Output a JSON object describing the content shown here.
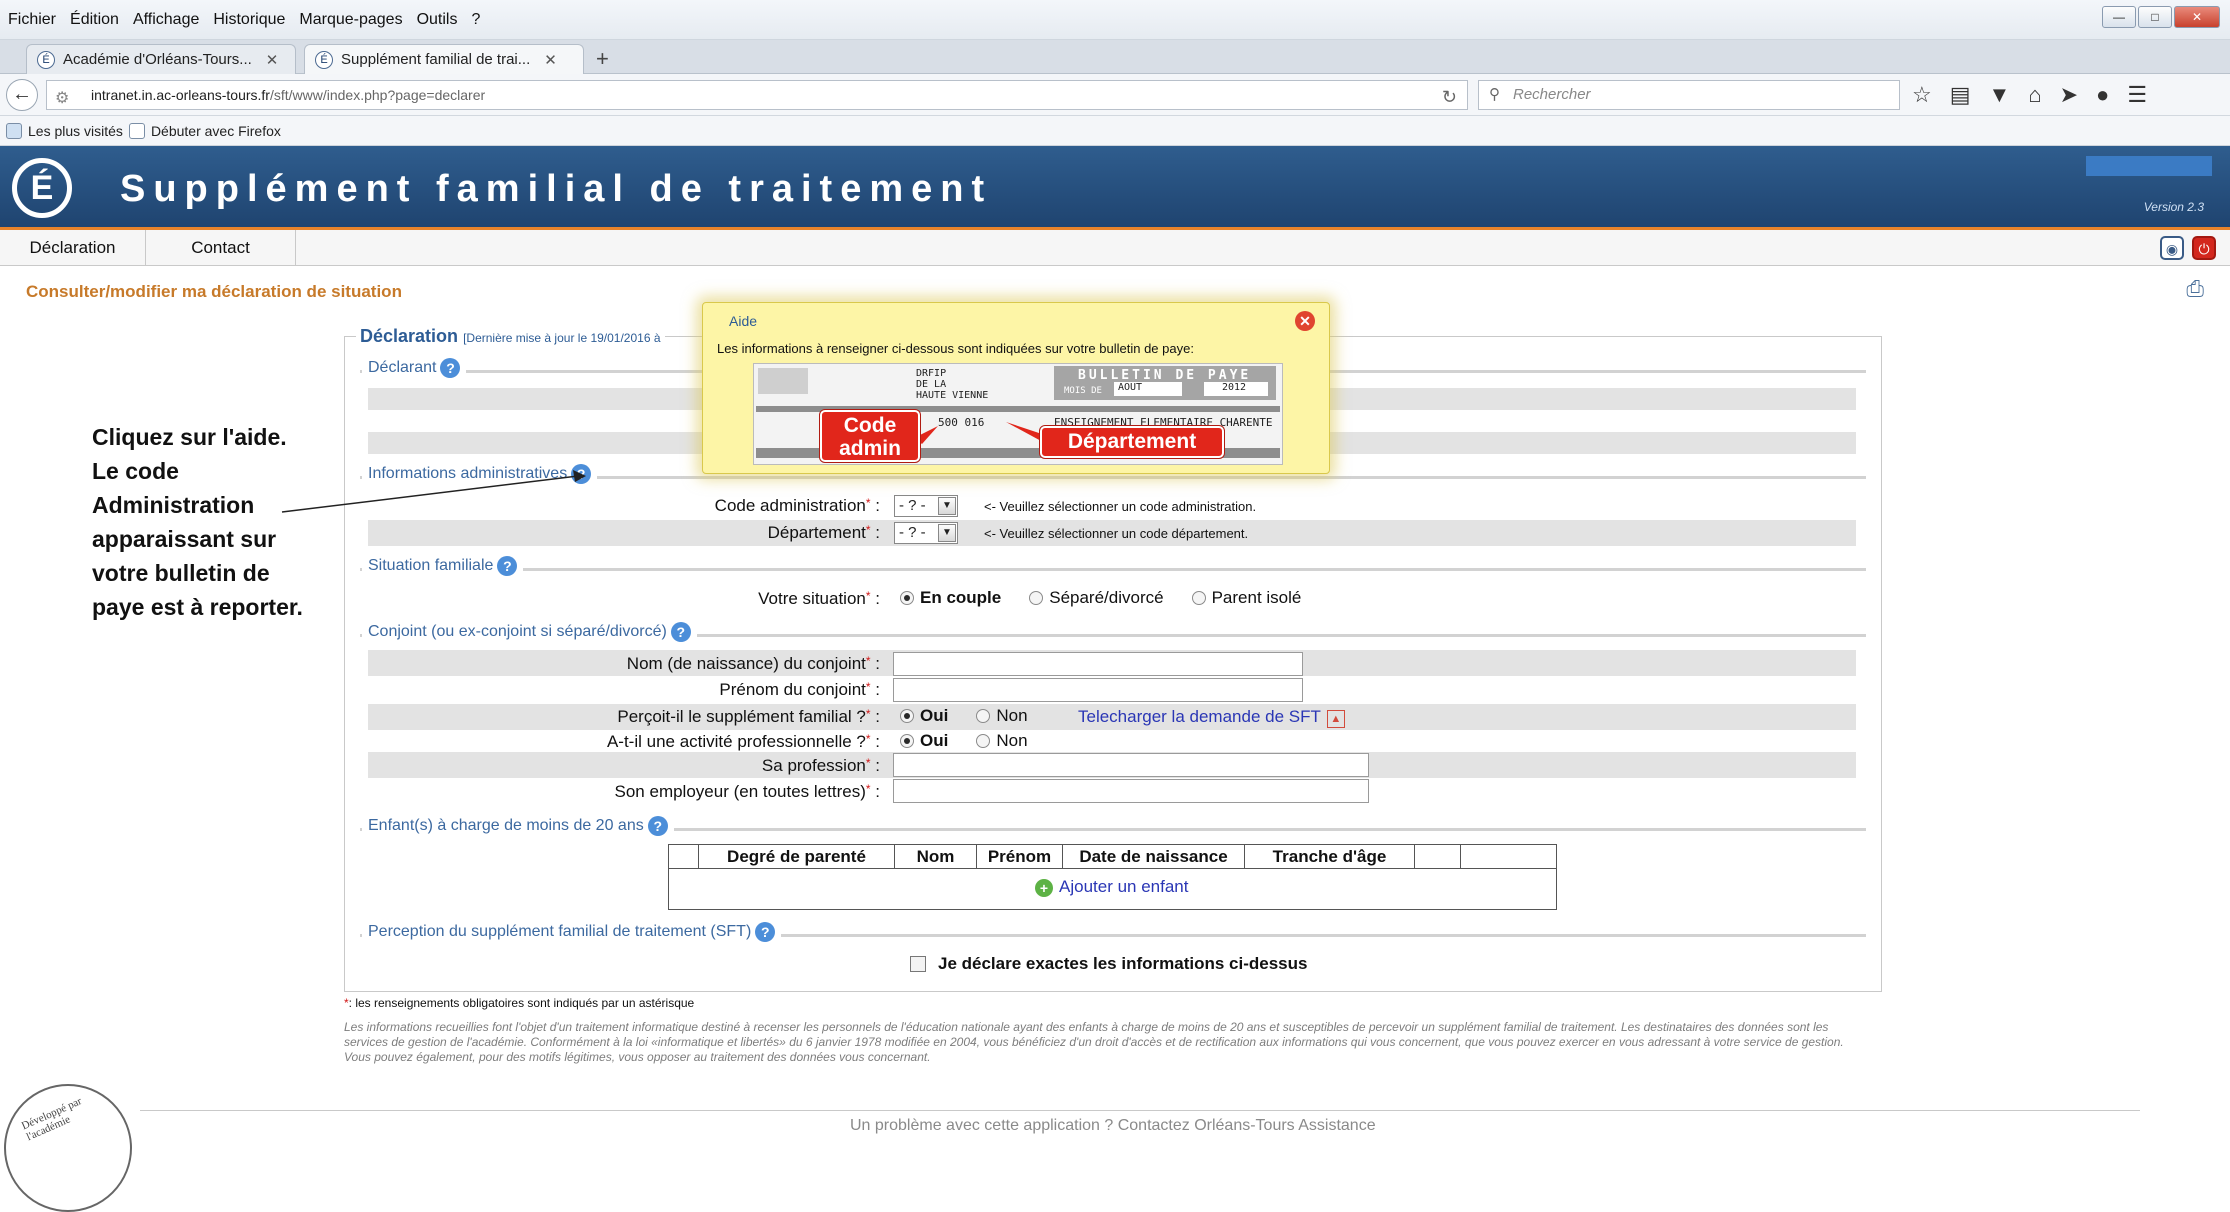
{
  "browser": {
    "menu": [
      "Fichier",
      "Édition",
      "Affichage",
      "Historique",
      "Marque-pages",
      "Outils",
      "?"
    ],
    "tabs": [
      {
        "label": "Académie d'Orléans-Tours..."
      },
      {
        "label": "Supplément familial de trai..."
      }
    ],
    "url": {
      "host": "intranet.in.ac-orleans-tours.fr",
      "path": "/sft/www/index.php?page=declarer"
    },
    "search_placeholder": "Rechercher",
    "bookmarks": [
      "Les plus visités",
      "Débuter avec Firefox"
    ]
  },
  "app": {
    "logo": "É",
    "title": "Supplément familial de traitement",
    "version": "Version 2.3",
    "menu": [
      "Déclaration",
      "Contact"
    ]
  },
  "page": {
    "heading": "Consulter/modifier ma déclaration de situation",
    "form_legend": "Déclaration",
    "form_legend_sub": "[Dernière mise à jour le 19/01/2016 à",
    "sections": {
      "declarant": "Déclarant",
      "admin_info": "Informations administratives",
      "family": "Situation familiale",
      "spouse": "Conjoint (ou ex-conjoint si séparé/divorcé)",
      "children": "Enfant(s) à charge de moins de 20 ans",
      "sft": "Perception du supplément familial de traitement (SFT)"
    },
    "admin": {
      "code_label": "Code administration",
      "code_value": "- ? -",
      "code_hint": "<- Veuillez sélectionner un code administration.",
      "dept_label": "Département",
      "dept_value": "- ? -",
      "dept_hint": "<- Veuillez sélectionner un code département."
    },
    "family": {
      "label": "Votre situation",
      "options": [
        "En couple",
        "Séparé/divorcé",
        "Parent isolé"
      ],
      "selected": "En couple"
    },
    "spouse": {
      "birth_name_label": "Nom (de naissance) du conjoint",
      "first_name_label": "Prénom du conjoint",
      "sft_label": "Perçoit-il le supplément familial ?",
      "sft_yes": "Oui",
      "sft_no": "Non",
      "download_link": "Telecharger la demande de SFT",
      "activity_label": "A-t-il une activité professionnelle ?",
      "activity_yes": "Oui",
      "activity_no": "Non",
      "profession_label": "Sa profession",
      "employer_label": "Son employeur (en toutes lettres)"
    },
    "children_table": {
      "headers": [
        "Degré de parenté",
        "Nom",
        "Prénom",
        "Date de naissance",
        "Tranche d'âge",
        "",
        ""
      ],
      "add_label": "Ajouter un enfant"
    },
    "declare_label": "Je déclare exactes les informations ci-dessus",
    "mandatory_note": ": les renseignements obligatoires sont indiqués par un astérisque",
    "legal_text": "Les informations recueillies font l'objet d'un traitement informatique destiné à recenser les personnels de l'éducation nationale ayant des enfants à charge de moins de 20 ans et susceptibles de percevoir un supplément familial de traitement. Les destinataires des données sont les services de gestion de l'académie. Conformément à la loi «informatique et libertés» du 6 janvier 1978 modifiée en 2004, vous bénéficiez d'un droit d'accès et de rectification aux informations qui vous concernent, que vous pouvez exercer en vous adressant à votre service de gestion. Vous pouvez également, pour des motifs légitimes, vous opposer au traitement des données vous concernant.",
    "footer": "Un problème avec cette application ? Contactez Orléans-Tours Assistance",
    "seal_text": "Développé par l'académie"
  },
  "popup": {
    "title": "Aide",
    "text": "Les informations à renseigner ci-dessous sont indiquées sur votre bulletin de paye:",
    "payslip": {
      "drfip": "DRFIP\nDE LA\nHAUTE VIENNE",
      "banner": "BULLETIN DE PAYE",
      "mois_label": "MOIS DE",
      "month": "AOUT",
      "year": "2012",
      "numbers": "500  016",
      "libelle": "ENSEIGNEMENT ELEMENTAIRE CHARENTE"
    },
    "callout_code": "Code admin",
    "callout_dept": "Département"
  },
  "annotation": {
    "lines": [
      "Cliquez sur l'aide.",
      "Le code",
      "Administration",
      "apparaissant sur",
      "votre bulletin de",
      "paye est à reporter."
    ]
  }
}
